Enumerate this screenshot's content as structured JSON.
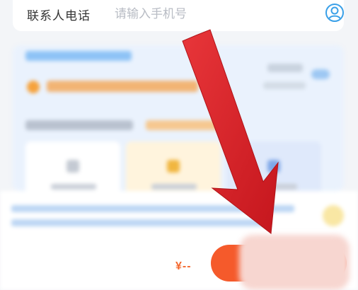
{
  "contact": {
    "label": "联系人电话",
    "placeholder": "请输入手机号",
    "icon": "user-circle-icon"
  },
  "footer": {
    "price": "¥--"
  },
  "colors": {
    "accent": "#3aa0e8",
    "primary_action": "#f55a2b",
    "arrow": "#d9262b"
  }
}
